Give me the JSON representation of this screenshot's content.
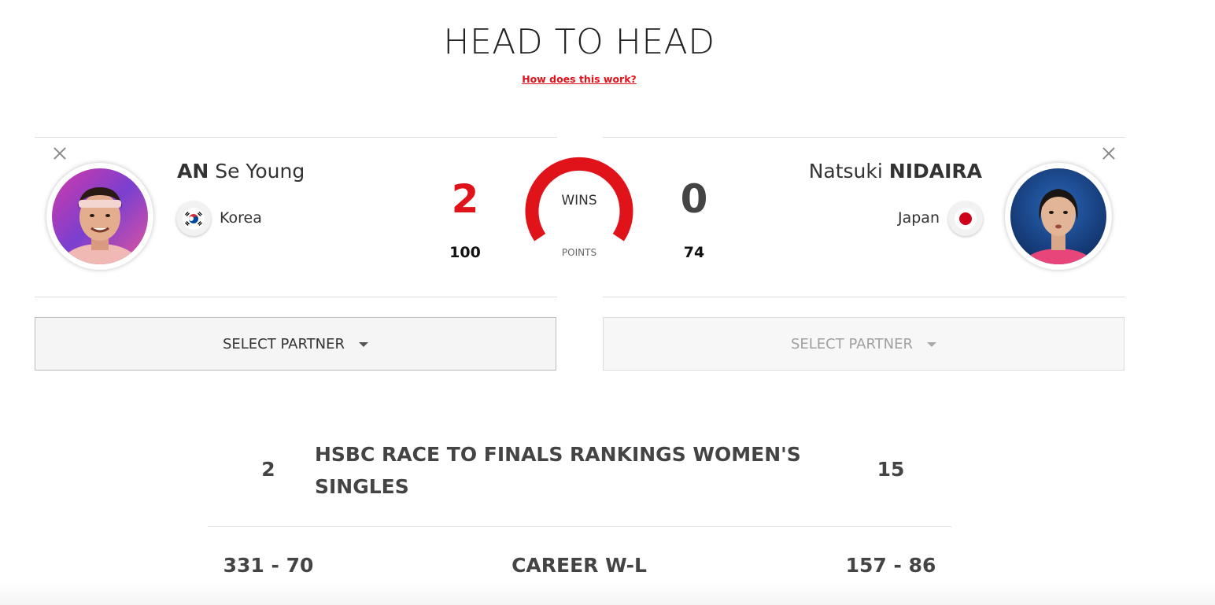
{
  "header": {
    "title": "HEAD TO HEAD",
    "help_link": "How does this work?"
  },
  "players": {
    "left": {
      "surname": "AN",
      "given_name": "Se Young",
      "country": "Korea",
      "wins": "2",
      "points": "100",
      "select_partner": "SELECT PARTNER"
    },
    "right": {
      "given_name": "Natsuki",
      "surname": "NIDAIRA",
      "country": "Japan",
      "wins": "0",
      "points": "74",
      "select_partner": "SELECT PARTNER"
    }
  },
  "center": {
    "wins_label": "WINS",
    "points_label": "POINTS",
    "wins_share": 1.0
  },
  "stats": [
    {
      "left": "2",
      "label": "HSBC RACE TO FINALS RANKINGS WOMEN'S SINGLES",
      "right": "15"
    },
    {
      "left": "331 - 70",
      "label": "CAREER W-L",
      "right": "157 - 86"
    }
  ],
  "colors": {
    "accent": "#e0121a",
    "left_wins": "#e0121a",
    "right_wins": "#444444",
    "gauge_track": "#e0121a"
  },
  "icons": {
    "close": "close-icon",
    "dropdown": "caret-down-icon",
    "korea_flag": "korea-flag-icon",
    "japan_flag": "japan-flag-icon"
  }
}
